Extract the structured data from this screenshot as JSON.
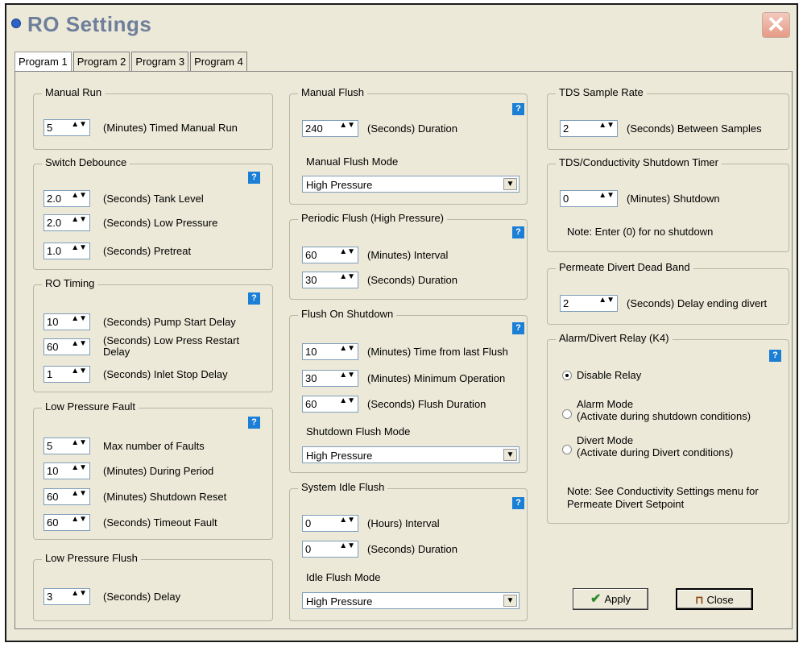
{
  "window": {
    "title": "RO Settings",
    "close_glyph": "✕"
  },
  "tabs": [
    "Program 1",
    "Program 2",
    "Program 3",
    "Program 4"
  ],
  "manual_run": {
    "legend": "Manual Run",
    "value": "5",
    "label": "(Minutes) Timed Manual Run"
  },
  "switch_debounce": {
    "legend": "Switch Debounce",
    "rows": [
      {
        "value": "2.0",
        "label": "(Seconds) Tank Level"
      },
      {
        "value": "2.0",
        "label": "(Seconds) Low Pressure"
      },
      {
        "value": "1.0",
        "label": "(Seconds) Pretreat"
      }
    ]
  },
  "ro_timing": {
    "legend": "RO Timing",
    "rows": [
      {
        "value": "10",
        "label": "(Seconds) Pump Start Delay"
      },
      {
        "value": "60",
        "label": "(Seconds) Low Press Restart Delay"
      },
      {
        "value": "1",
        "label": "(Seconds) Inlet Stop Delay"
      }
    ]
  },
  "low_pressure_fault": {
    "legend": "Low Pressure Fault",
    "rows": [
      {
        "value": "5",
        "label": "Max number of Faults"
      },
      {
        "value": "10",
        "label": "(Minutes) During Period"
      },
      {
        "value": "60",
        "label": "(Minutes) Shutdown Reset"
      },
      {
        "value": "60",
        "label": "(Seconds) Timeout Fault"
      }
    ]
  },
  "low_pressure_flush": {
    "legend": "Low Pressure Flush",
    "value": "3",
    "label": "(Seconds) Delay"
  },
  "manual_flush": {
    "legend": "Manual Flush",
    "value": "240",
    "label": "(Seconds) Duration",
    "mode_label": "Manual Flush Mode",
    "mode_value": "High Pressure"
  },
  "periodic_flush": {
    "legend": "Periodic Flush (High Pressure)",
    "rows": [
      {
        "value": "60",
        "label": "(Minutes) Interval"
      },
      {
        "value": "30",
        "label": "(Seconds) Duration"
      }
    ]
  },
  "flush_on_shutdown": {
    "legend": "Flush On Shutdown",
    "rows": [
      {
        "value": "10",
        "label": "(Minutes) Time from last Flush"
      },
      {
        "value": "30",
        "label": "(Minutes) Minimum Operation"
      },
      {
        "value": "60",
        "label": "(Seconds) Flush Duration"
      }
    ],
    "mode_label": "Shutdown Flush Mode",
    "mode_value": "High Pressure"
  },
  "system_idle_flush": {
    "legend": "System Idle Flush",
    "rows": [
      {
        "value": "0",
        "label": "(Hours) Interval"
      },
      {
        "value": "0",
        "label": "(Seconds) Duration"
      }
    ],
    "mode_label": "Idle Flush Mode",
    "mode_value": "High Pressure"
  },
  "tds_sample_rate": {
    "legend": "TDS Sample Rate",
    "value": "2",
    "label": "(Seconds) Between Samples"
  },
  "tds_shutdown_timer": {
    "legend": "TDS/Conductivity Shutdown Timer",
    "value": "0",
    "label": "(Minutes) Shutdown",
    "note": "Note: Enter (0) for no shutdown"
  },
  "permeate_divert": {
    "legend": "Permeate Divert Dead Band",
    "value": "2",
    "label": "(Seconds) Delay ending divert"
  },
  "alarm_relay": {
    "legend": "Alarm/Divert Relay (K4)",
    "options": [
      {
        "label": "Disable Relay",
        "sub": "",
        "checked": true
      },
      {
        "label": "Alarm Mode",
        "sub": "(Activate during shutdown conditions)",
        "checked": false
      },
      {
        "label": "Divert Mode",
        "sub": "(Activate during Divert conditions)",
        "checked": false
      }
    ],
    "note_line1": "Note: See Conductivity Settings menu for",
    "note_line2": "Permeate Divert Setpoint"
  },
  "buttons": {
    "apply": "Apply",
    "close": "Close"
  },
  "help_glyph": "?",
  "spin_glyph": "▲▼",
  "dropdown_glyph": "▼"
}
